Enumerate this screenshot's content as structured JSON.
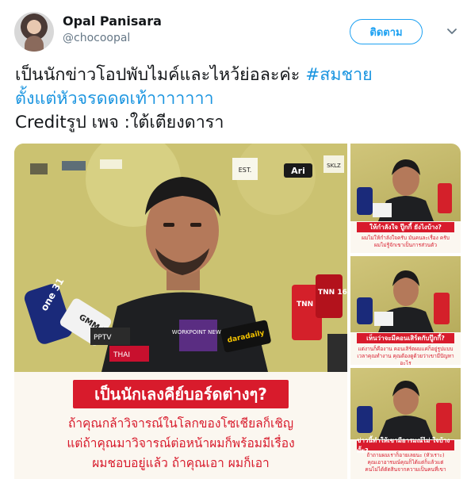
{
  "user": {
    "name": "Opal Panisara",
    "handle": "@chocoopal",
    "follow_label": "ติดตาม"
  },
  "tweet": {
    "line1_text": "เป็นนักข่าวโอปพับไมค์และไหว้ย่อละค่ะ ",
    "line1_hashtag": "#สมชาย",
    "line2_hashtag": "ตั้งแต่หัวจรดดดเท้าาาาาาา",
    "line3_text": "Creditรูป เพจ :ใต้เตียงดารา"
  },
  "main_image": {
    "logos": [
      "Ari",
      "SKLZ",
      "EST."
    ],
    "mics": [
      "one 31",
      "GMM 25",
      "PPTV",
      "THAI",
      "WORKPOINT NEWS",
      "daradaily",
      "TNN 16",
      "TNN 16"
    ],
    "caption_title": "เป็นนักเลงคีย์บอร์ดต่างๆ?",
    "caption_lines": [
      "ถ้าคุณกล้าวิจารณ์ในโลกของโซเชียลก็เชิญ",
      "แต่ถ้าคุณมาวิจารณ์ต่อหน้าผมก็พร้อมมีเรื่อง",
      "ผมชอบอยู่แล้ว ถ้าคุณเอา ผมก็เอา"
    ]
  },
  "thumbnails": [
    {
      "title": "ให้กำลังใจ ปู๊กกี้ ยังไงบ้าง?",
      "lines": [
        "ผมไม่ให้กำลังใจครับ มันคนละเรื่อง ครับ",
        "ผมไม่รู้จักเขาเป็นการส่วนตัว"
      ]
    },
    {
      "title": "เห็นว่าจะมีคอนเสิร์ตกับปู๊กกี้?",
      "lines": [
        "แต่งานก็คืองาน คอนเสิร์ตผมแค่ก็อยู่รูปแบบ",
        "เวลาคุณทำงาน คุณต้องดูด้วยว่าเขามีปัญหาอะไร"
      ]
    },
    {
      "title": "ข่าวนี้ทำให้เขามีอารมณ์ไม่ ใจบ้างมั้ย?",
      "lines": [
        "ถ้าถามผมเราก็อายเลยนะ (หัวเราะ)",
        "คุณเอาอารมณ์คุณก็ได้แต่ก็แล้วแต่",
        "คนไม่ได้ตัดสินจากความเป็นคนที่เขา"
      ]
    }
  ],
  "colors": {
    "accent": "#1da1f2",
    "hashtag": "#1b95e0",
    "caption_red": "#d81b2c"
  }
}
